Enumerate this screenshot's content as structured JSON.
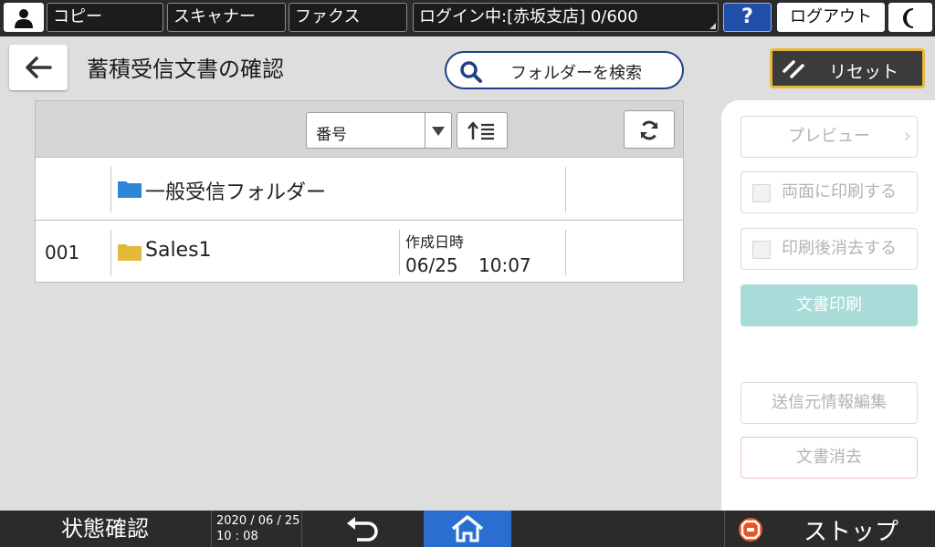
{
  "topbar": {
    "copy_label": "コピー",
    "scanner_label": "スキャナー",
    "fax_label": "ファクス",
    "login_status": "ログイン中:[赤坂支店] 0/600",
    "help_label": "?",
    "logout_label": "ログアウト"
  },
  "header": {
    "title": "蓄積受信文書の確認",
    "search_folder_label": "フォルダーを検索",
    "reset_label": "リセット"
  },
  "list": {
    "sort_value": "番号",
    "rows": [
      {
        "number": "",
        "name": "一般受信フォルダー",
        "icon": "blue-folder-icon"
      },
      {
        "number": "001",
        "name": "Sales1",
        "icon": "yellow-folder-icon",
        "date_label": "作成日時",
        "date": "06/25",
        "time": "10:07"
      }
    ]
  },
  "actions": {
    "preview": "プレビュー",
    "duplex_print": "両面に印刷する",
    "delete_after_print": "印刷後消去する",
    "print_document": "文書印刷",
    "edit_sender_info": "送信元情報編集",
    "delete_document": "文書消去"
  },
  "bottombar": {
    "status_check": "状態確認",
    "date": "2020 / 06 / 25",
    "time": "10 : 08",
    "stop_label": "ストップ"
  },
  "colors": {
    "accent_blue": "#2a6fcf",
    "reset_border": "#e8b93d",
    "print_button": "#a9dcd8",
    "folder_blue": "#2a86d6",
    "folder_yellow": "#e3b93a"
  }
}
